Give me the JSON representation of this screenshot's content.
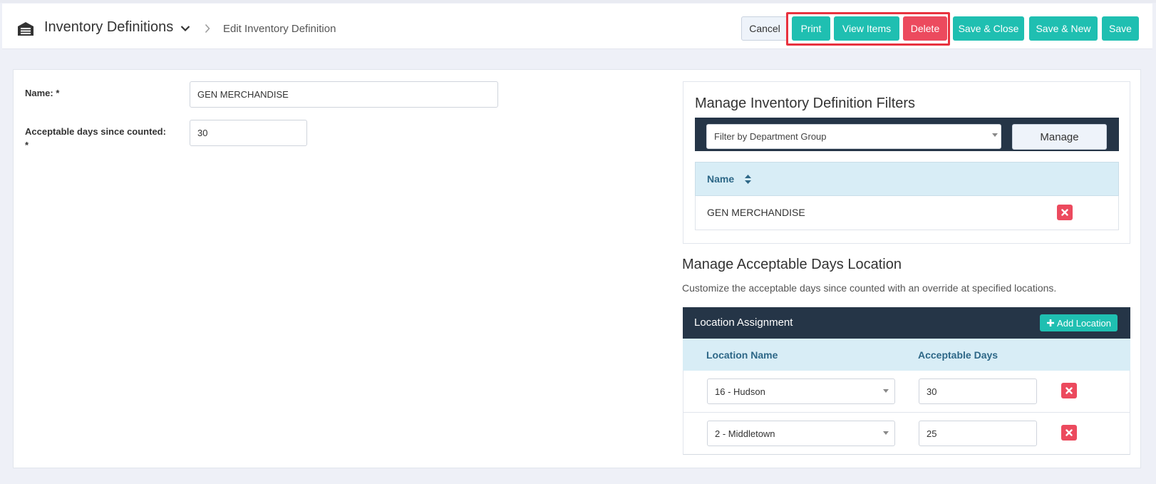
{
  "header": {
    "title": "Inventory Definitions",
    "breadcrumb_current": "Edit Inventory Definition",
    "icon": "warehouse-icon"
  },
  "toolbar": {
    "cancel_label": "Cancel",
    "print_label": "Print",
    "view_items_label": "View Items",
    "delete_label": "Delete",
    "save_close_label": "Save & Close",
    "save_new_label": "Save & New",
    "save_label": "Save"
  },
  "form": {
    "name_label": "Name: *",
    "name_value": "GEN MERCHANDISE",
    "days_label_line1": "Acceptable days since counted:",
    "days_label_line2": "*",
    "days_value": "30"
  },
  "filters": {
    "title": "Manage Inventory Definition Filters",
    "select_value": "Filter by Department Group",
    "manage_label": "Manage",
    "column_name": "Name",
    "rows": [
      {
        "name": "GEN MERCHANDISE"
      }
    ]
  },
  "locations": {
    "title": "Manage Acceptable Days Location",
    "description": "Customize the acceptable days since counted with an override at specified locations.",
    "bar_title": "Location Assignment",
    "add_label": "Add Location",
    "col_location": "Location Name",
    "col_days": "Acceptable Days",
    "rows": [
      {
        "location": "16 - Hudson",
        "days": "30"
      },
      {
        "location": "2 - Middletown",
        "days": "25"
      }
    ]
  },
  "colors": {
    "accent": "#1fbfb1",
    "danger": "#ec4a5e",
    "dark_bar": "#253547",
    "table_head": "#d8edf6",
    "highlight": "#e8323f"
  }
}
